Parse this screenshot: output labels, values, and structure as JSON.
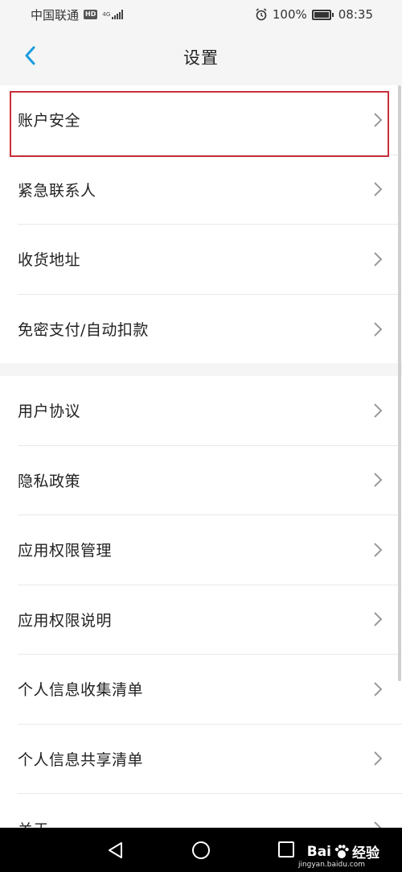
{
  "status_bar": {
    "carrier": "中国联通",
    "hd": "HD",
    "net_type": "4G",
    "battery": "100%",
    "time": "08:35"
  },
  "header": {
    "title": "设置"
  },
  "groups": [
    {
      "items": [
        {
          "label": "账户安全"
        },
        {
          "label": "紧急联系人"
        },
        {
          "label": "收货地址"
        },
        {
          "label": "免密支付/自动扣款"
        }
      ]
    },
    {
      "items": [
        {
          "label": "用户协议"
        },
        {
          "label": "隐私政策"
        },
        {
          "label": "应用权限管理"
        },
        {
          "label": "应用权限说明"
        },
        {
          "label": "个人信息收集清单"
        },
        {
          "label": "个人信息共享清单"
        },
        {
          "label": "关于"
        }
      ]
    }
  ],
  "watermark": {
    "brand": "Bai",
    "brand_cn": "经验",
    "url": "jingyan.baidu.com"
  },
  "colors": {
    "accent": "#1a9be0",
    "highlight": "#c8303a"
  }
}
